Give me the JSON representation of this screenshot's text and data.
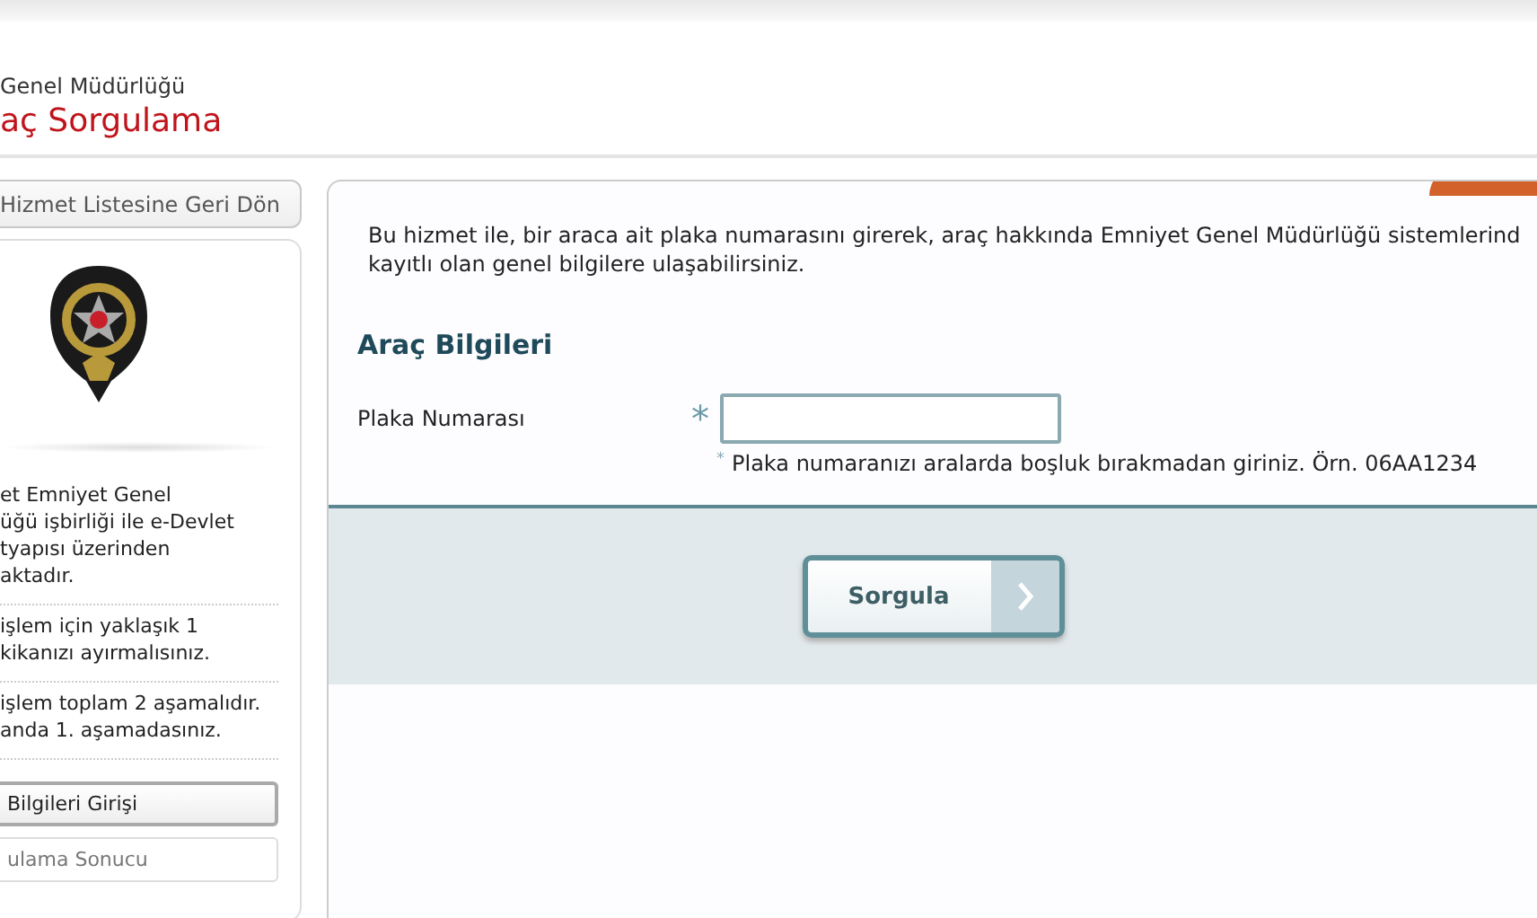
{
  "header": {
    "subtitle": "Genel Müdürlüğü",
    "title": "aç Sorgulama"
  },
  "sidebar": {
    "back_button": "Hizmet Listesine Geri Dön",
    "paragraphs": [
      {
        "lines": [
          "et Emniyet Genel",
          "üğü işbirliği ile e-Devlet",
          "tyapısı üzerinden",
          "aktadır."
        ]
      },
      {
        "lines": [
          "işlem için yaklaşık 1",
          "kikanızı ayırmalısınız."
        ]
      },
      {
        "lines": [
          "işlem toplam 2 aşamalıdır.",
          "anda 1. aşamadasınız."
        ]
      }
    ],
    "steps": [
      {
        "label": "Bilgileri Girişi",
        "selected": true
      },
      {
        "label": "ulama Sonucu",
        "selected": false
      }
    ]
  },
  "main": {
    "description": [
      "Bu hizmet ile, bir araca ait plaka numarasını girerek, araç hakkında Emniyet Genel Müdürlüğü sistemlerind",
      "kayıtlı olan genel bilgilere ulaşabilirsiniz."
    ],
    "section_title": "Araç Bilgileri",
    "field": {
      "label": "Plaka Numarası",
      "required_mark": "*",
      "hint_mark": "*",
      "hint": "Plaka numaranızı aralarda boşluk bırakmadan giriniz. Örn. 06AA1234"
    },
    "submit_button": "Sorgula"
  }
}
